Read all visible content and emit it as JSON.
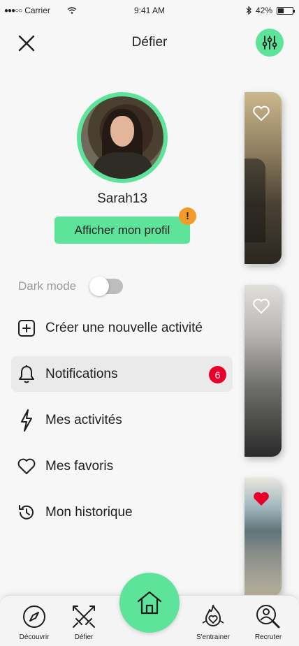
{
  "status_bar": {
    "carrier": "Carrier",
    "time": "9:41 AM",
    "battery": "42%",
    "battery_level": 0.42
  },
  "header": {
    "title": "Défier",
    "close_icon": "close-icon",
    "filter_icon": "sliders-icon"
  },
  "profile": {
    "username": "Sarah13",
    "view_profile_label": "Afficher mon profil",
    "alert_badge": "!"
  },
  "settings": {
    "dark_mode_label": "Dark mode",
    "dark_mode_enabled": false
  },
  "menu": {
    "items": [
      {
        "label": "Créer une nouvelle activité",
        "icon": "plus-square-icon"
      },
      {
        "label": "Notifications",
        "icon": "bell-icon",
        "badge": "6",
        "active": true
      },
      {
        "label": "Mes activités",
        "icon": "lightning-icon"
      },
      {
        "label": "Mes favoris",
        "icon": "heart-icon"
      },
      {
        "label": "Mon historique",
        "icon": "history-icon"
      }
    ]
  },
  "cards": [
    {
      "favorited": false
    },
    {
      "favorited": false
    },
    {
      "favorited": true
    }
  ],
  "tab_bar": {
    "tabs": [
      {
        "label": "Découvrir",
        "icon": "compass-icon"
      },
      {
        "label": "Défier",
        "icon": "crossed-swords-icon"
      },
      {
        "label": "",
        "icon": "home-icon"
      },
      {
        "label": "S'entrainer",
        "icon": "flame-heart-icon"
      },
      {
        "label": "Recruter",
        "icon": "person-search-icon"
      }
    ]
  },
  "colors": {
    "accent": "#5ee39a",
    "alert": "#f29b2a",
    "badge": "#e8002a",
    "heart_active": "#e8002a"
  }
}
